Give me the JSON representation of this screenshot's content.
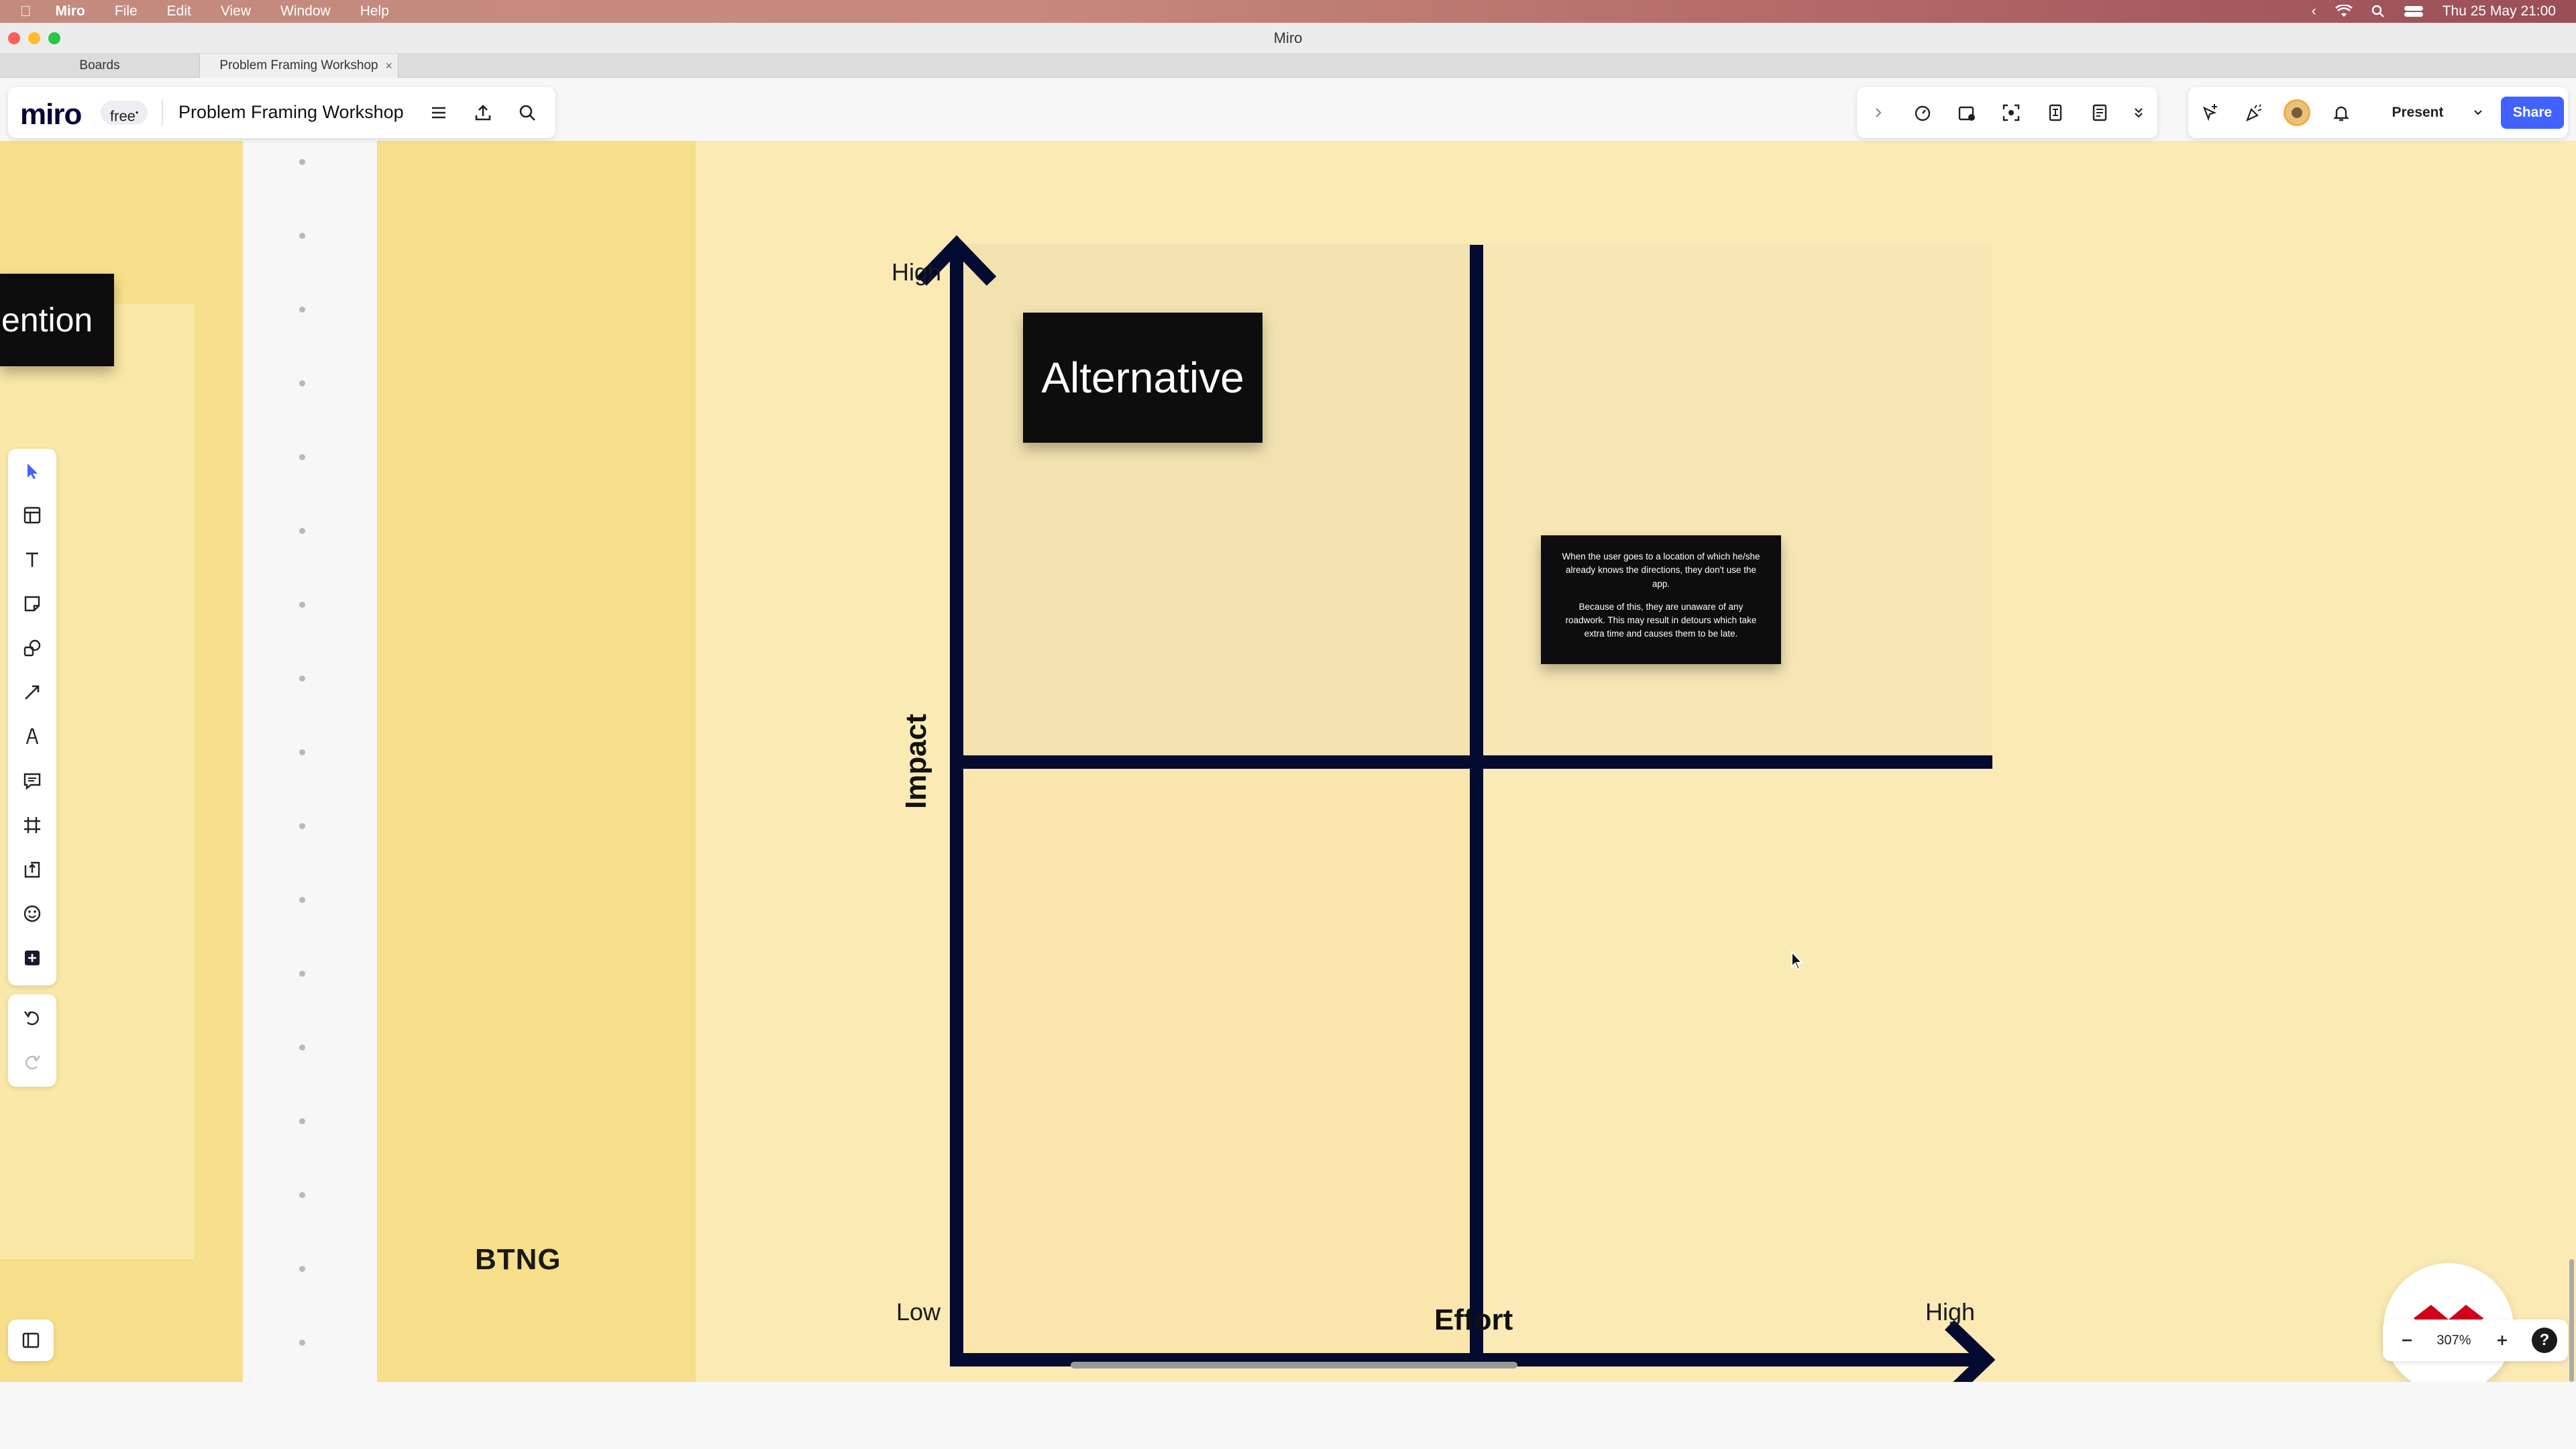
{
  "menubar": {
    "app_name": "Miro",
    "items": [
      "File",
      "Edit",
      "View",
      "Window",
      "Help"
    ],
    "datetime": "Thu 25 May  21:00"
  },
  "window": {
    "title": "Miro"
  },
  "tabs": [
    {
      "label": "Boards"
    },
    {
      "label": "Problem Framing Workshop"
    }
  ],
  "toolbar": {
    "logo": "miro",
    "plan_badge": "free",
    "board_title": "Problem Framing Workshop",
    "present_label": "Present",
    "share_label": "Share"
  },
  "board": {
    "left_sticky_text": "ention",
    "btng_label": "BTNG",
    "matrix": {
      "y_axis_label": "Impact",
      "x_axis_label": "Effort",
      "y_high_label": "High",
      "x_low_label": "Low",
      "x_high_label": "High"
    },
    "alternative_sticky": "Alternative",
    "note_sticky": {
      "paragraph1": "When the user goes to a location of which he/she already knows the directions, they don't use the app.",
      "paragraph2": "Because of this, they are unaware of any roadwork. This may result in detours which take extra time and causes them to be late."
    }
  },
  "zoom": {
    "level": "307%"
  },
  "colors": {
    "canvas_yellow": "#fbeab3",
    "frame_yellow": "#f7df8b",
    "axis_navy": "#050a30",
    "share_blue": "#4262ff",
    "brand_red": "#d0021b"
  }
}
